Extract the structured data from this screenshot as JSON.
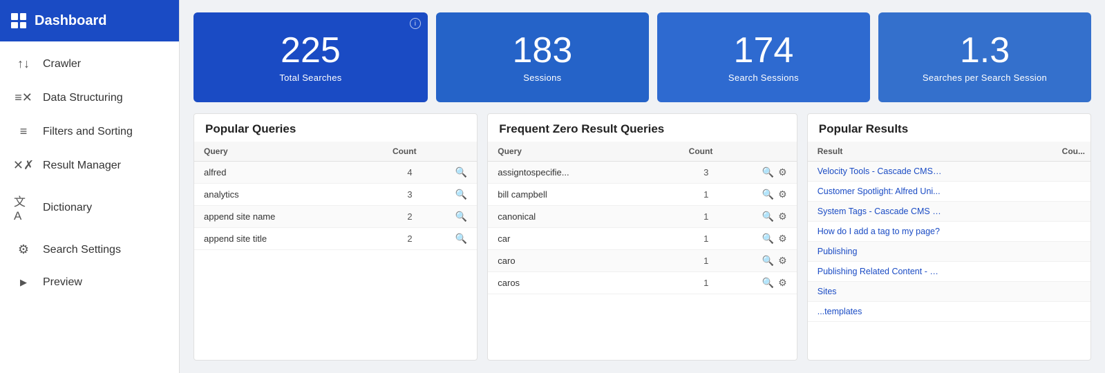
{
  "sidebar": {
    "title": "Dashboard",
    "items": [
      {
        "id": "crawler",
        "label": "Crawler",
        "icon": "↑↓"
      },
      {
        "id": "data-structuring",
        "label": "Data Structuring",
        "icon": "≡×"
      },
      {
        "id": "filters-sorting",
        "label": "Filters and Sorting",
        "icon": "≡"
      },
      {
        "id": "result-manager",
        "label": "Result Manager",
        "icon": "✕×"
      },
      {
        "id": "dictionary",
        "label": "Dictionary",
        "icon": "文A"
      },
      {
        "id": "search-settings",
        "label": "Search Settings",
        "icon": "⚙"
      },
      {
        "id": "preview",
        "label": "Preview",
        "icon": "▶"
      }
    ]
  },
  "stats": [
    {
      "id": "total-searches",
      "number": "225",
      "label": "Total Searches",
      "hasInfo": true
    },
    {
      "id": "sessions",
      "number": "183",
      "label": "Sessions",
      "hasInfo": false
    },
    {
      "id": "search-sessions",
      "number": "174",
      "label": "Search Sessions",
      "hasInfo": false
    },
    {
      "id": "searches-per-session",
      "number": "1.3",
      "label": "Searches per Search Session",
      "hasInfo": false
    }
  ],
  "popularQueries": {
    "title": "Popular Queries",
    "columns": {
      "query": "Query",
      "count": "Count"
    },
    "rows": [
      {
        "query": "alfred",
        "count": "4"
      },
      {
        "query": "analytics",
        "count": "3"
      },
      {
        "query": "append site name",
        "count": "2"
      },
      {
        "query": "append site title",
        "count": "2"
      }
    ]
  },
  "zeroResults": {
    "title": "Frequent Zero Result Queries",
    "columns": {
      "query": "Query",
      "count": "Count"
    },
    "rows": [
      {
        "query": "assigntospecifie...",
        "count": "3"
      },
      {
        "query": "bill campbell",
        "count": "1"
      },
      {
        "query": "canonical",
        "count": "1"
      },
      {
        "query": "car",
        "count": "1"
      },
      {
        "query": "caro",
        "count": "1"
      },
      {
        "query": "caros",
        "count": "1"
      }
    ]
  },
  "popularResults": {
    "title": "Popular Results",
    "columns": {
      "result": "Result",
      "count": "Cou..."
    },
    "rows": [
      {
        "result": "Velocity Tools - Cascade CMS ...",
        "count": ""
      },
      {
        "result": "Customer Spotlight: Alfred Uni...",
        "count": ""
      },
      {
        "result": "System Tags - Cascade CMS K...",
        "count": ""
      },
      {
        "result": "How do I add a tag to my page?",
        "count": ""
      },
      {
        "result": "Publishing",
        "count": ""
      },
      {
        "result": "Publishing Related Content - Ca...",
        "count": ""
      },
      {
        "result": "Sites",
        "count": ""
      },
      {
        "result": "...templates",
        "count": ""
      }
    ]
  }
}
